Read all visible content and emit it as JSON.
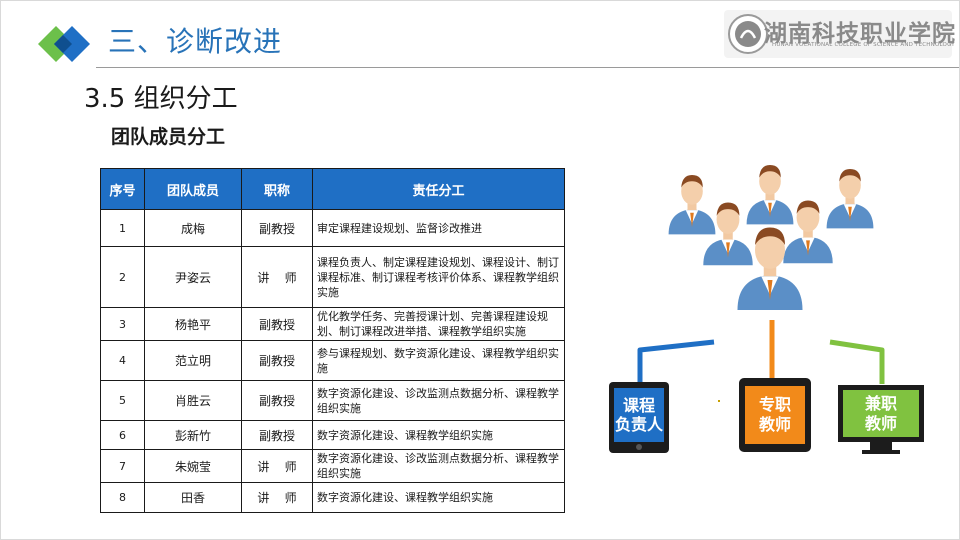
{
  "header": {
    "section_title": "三、诊断改进",
    "school_name_cn": "湖南科技职业学院",
    "school_name_en": "HUNAN VOCATIONAL COLLEGE OF SCIENCE AND TECHNOLOGY"
  },
  "subsection_title": "3.5  组织分工",
  "team_title": "团队成员分工",
  "table": {
    "headers": [
      "序号",
      "团队成员",
      "职称",
      "责任分工"
    ],
    "rows": [
      {
        "no": "1",
        "name": "成梅",
        "title": "副教授",
        "duty": "审定课程建设规划、监督诊改推进"
      },
      {
        "no": "2",
        "name": "尹姿云",
        "title": "讲    师",
        "duty": "课程负责人、制定课程建设规划、课程设计、制订课程标准、制订课程考核评价体系、课程教学组织实施"
      },
      {
        "no": "3",
        "name": "杨艳平",
        "title": "副教授",
        "duty": "优化教学任务、完善授课计划、完善课程建设规划、制订课程改进举措、课程教学组织实施"
      },
      {
        "no": "4",
        "name": "范立明",
        "title": "副教授",
        "duty": "参与课程规划、数字资源化建设、课程教学组织实施"
      },
      {
        "no": "5",
        "name": "肖胜云",
        "title": "副教授",
        "duty": "数字资源化建设、诊改监测点数据分析、课程教学组织实施"
      },
      {
        "no": "6",
        "name": "彭新竹",
        "title": "副教授",
        "duty": "数字资源化建设、课程教学组织实施"
      },
      {
        "no": "7",
        "name": "朱婉莹",
        "title": "讲    师",
        "duty": "数字资源化建设、诊改监测点数据分析、课程教学组织实施"
      },
      {
        "no": "8",
        "name": "田香",
        "title": "讲    师",
        "duty": "数字资源化建设、课程教学组织实施"
      }
    ]
  },
  "roles": [
    {
      "line1": "课程",
      "line2": "负责人",
      "color": "#1f6fc5",
      "device": "tablet"
    },
    {
      "line1": "专职",
      "line2": "教师",
      "color": "#f28a1a",
      "device": "phone"
    },
    {
      "line1": "兼职",
      "line2": "教师",
      "color": "#80c240",
      "device": "monitor"
    }
  ],
  "colors": {
    "accent_blue": "#2873b8",
    "table_header": "#1f6fc5",
    "logo_green": "#6cc04a"
  }
}
